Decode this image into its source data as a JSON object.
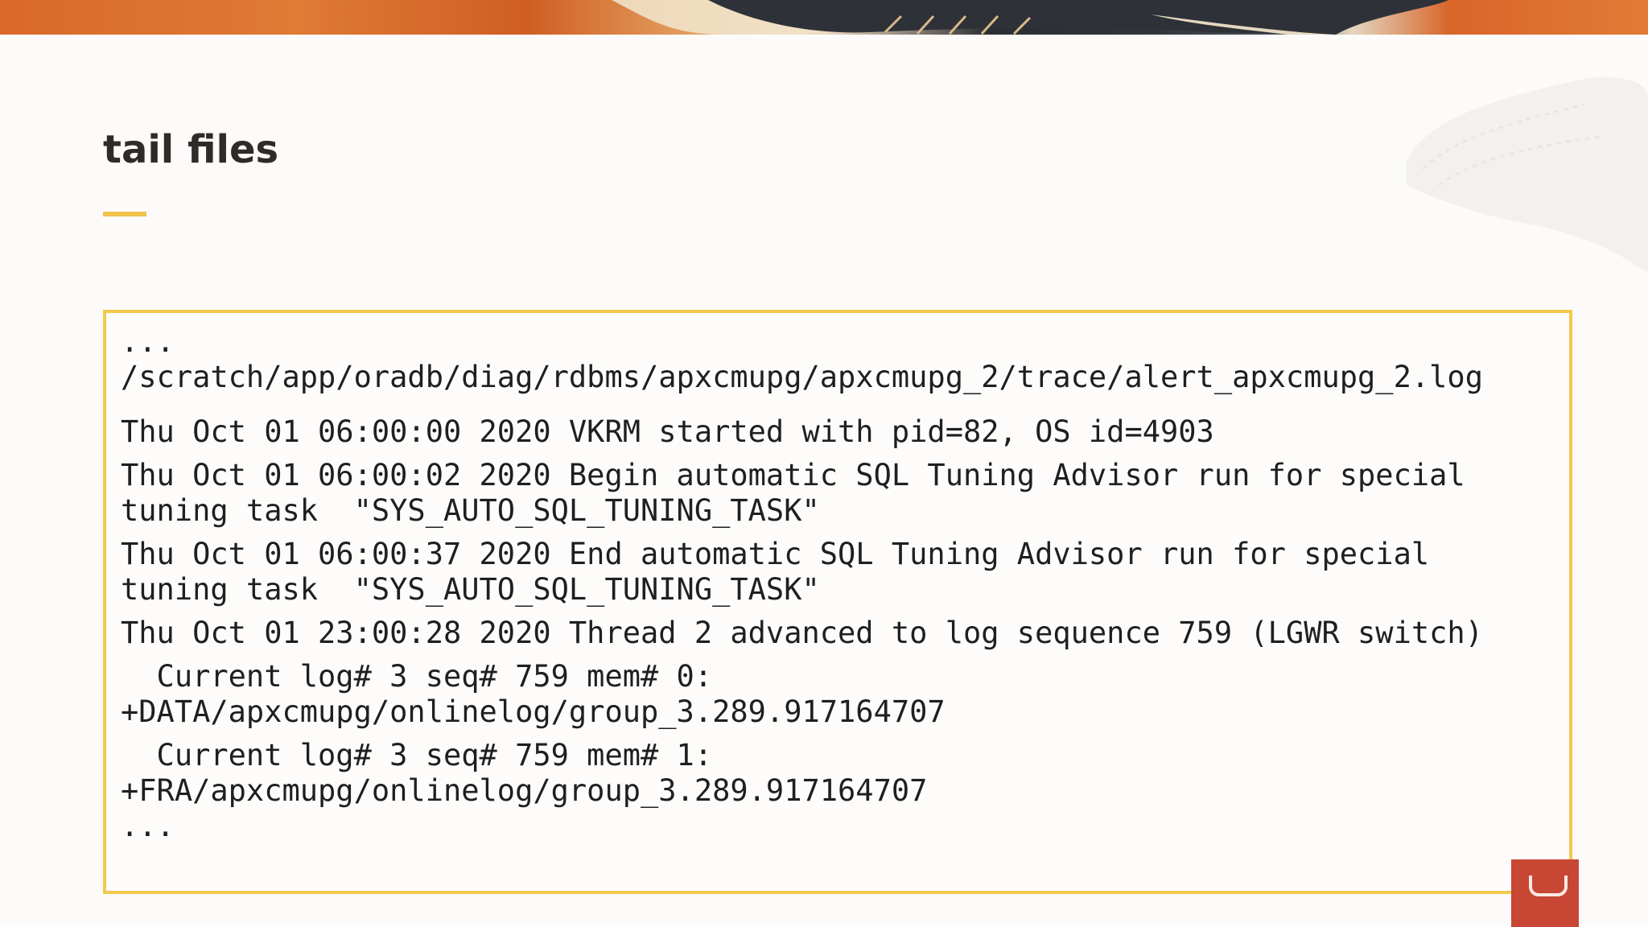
{
  "slide": {
    "title": "tail files"
  },
  "code": {
    "lines": [
      "...",
      "/scratch/app/oradb/diag/rdbms/apxcmupg/apxcmupg_2/trace/alert_apxcmupg_2.log",
      "Thu Oct 01 06:00:00 2020 VKRM started with pid=82, OS id=4903",
      "Thu Oct 01 06:00:02 2020 Begin automatic SQL Tuning Advisor run for special",
      "tuning task  \"SYS_AUTO_SQL_TUNING_TASK\"",
      "Thu Oct 01 06:00:37 2020 End automatic SQL Tuning Advisor run for special",
      "tuning task  \"SYS_AUTO_SQL_TUNING_TASK\"",
      "Thu Oct 01 23:00:28 2020 Thread 2 advanced to log sequence 759 (LGWR switch)",
      "  Current log# 3 seq# 759 mem# 0:",
      "+DATA/apxcmupg/onlinelog/group_3.289.917164707",
      "  Current log# 3 seq# 759 mem# 1:",
      "+FRA/apxcmupg/onlinelog/group_3.289.917164707",
      "..."
    ]
  },
  "colors": {
    "accent": "#f2c14e",
    "title": "#2f2b28",
    "brand": "#c74634"
  }
}
